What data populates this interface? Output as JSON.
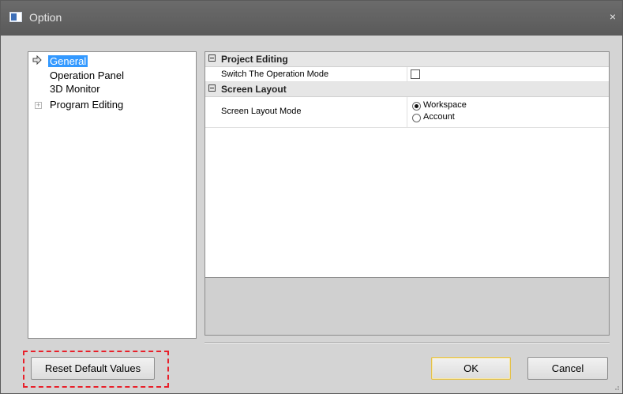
{
  "window": {
    "title": "Option",
    "close_glyph": "×"
  },
  "tree": {
    "items": [
      {
        "label": "General",
        "selected": true,
        "marker": "arrow-icon"
      },
      {
        "label": "Operation Panel"
      },
      {
        "label": "3D Monitor"
      },
      {
        "label": "Program Editing",
        "expander": "+"
      }
    ]
  },
  "properties": {
    "categories": [
      {
        "label": "Project Editing",
        "rows": [
          {
            "name": "Switch The Operation Mode",
            "type": "checkbox",
            "checked": false
          }
        ]
      },
      {
        "label": "Screen Layout",
        "rows": [
          {
            "name": "Screen Layout Mode",
            "type": "radio",
            "options": [
              "Workspace",
              "Account"
            ],
            "selected": "Workspace"
          }
        ]
      }
    ]
  },
  "buttons": {
    "reset": "Reset Default Values",
    "ok": "OK",
    "cancel": "Cancel"
  },
  "colors": {
    "highlight": "#e8202a",
    "selection": "#3399ff",
    "title_bar": "#5a5a5a",
    "default_button_border": "#e3c14a"
  }
}
